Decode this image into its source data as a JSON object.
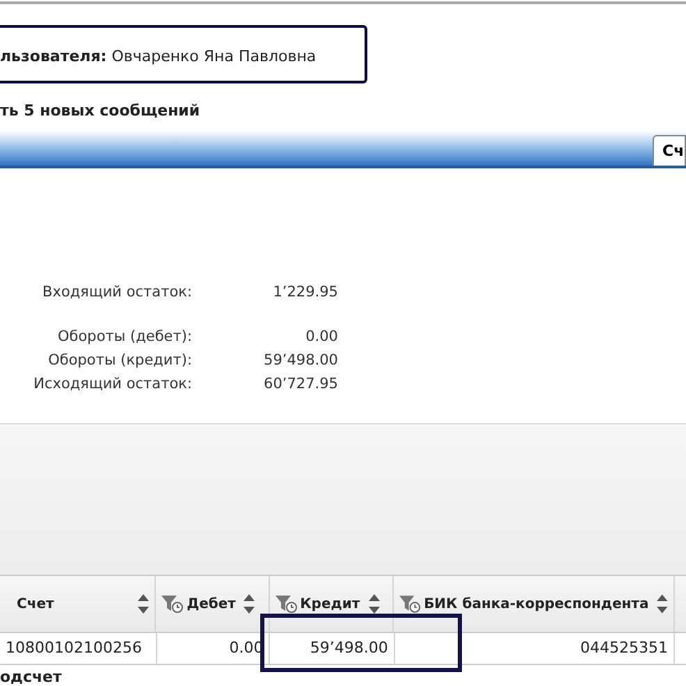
{
  "user": {
    "label": "льзователя:",
    "name": "Овчаренко Яна Павловна"
  },
  "messages": "ть 5 новых сообщений",
  "tabs": [
    {
      "label": "Сч",
      "selected": true
    }
  ],
  "summary": [
    {
      "label": "Входящий остаток:",
      "value": "1’229.95"
    },
    {
      "label": "Обороты (дебет):",
      "value": "0.00"
    },
    {
      "label": "Обороты (кредит):",
      "value": "59’498.00"
    },
    {
      "label": "Исходящий остаток:",
      "value": "60’727.95"
    }
  ],
  "table": {
    "columns": [
      {
        "label": "Счет",
        "filter": false
      },
      {
        "label": "Дебет",
        "filter": true
      },
      {
        "label": "Кредит",
        "filter": true
      },
      {
        "label": "БИК банка-корреспондента",
        "filter": true
      }
    ],
    "rows": [
      [
        "10800102100256",
        "0.00",
        "59’498.00",
        "044525351"
      ]
    ],
    "footer": "одсчет"
  }
}
